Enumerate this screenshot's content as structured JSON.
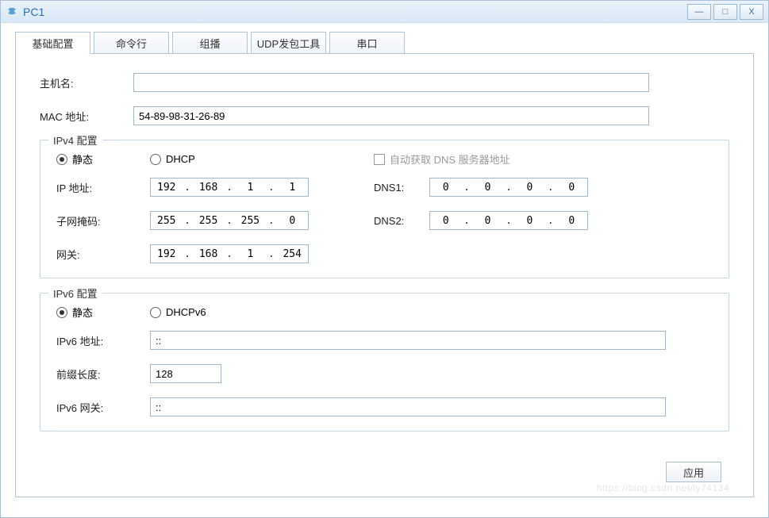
{
  "window": {
    "title": "PC1"
  },
  "tabs": {
    "basic": "基础配置",
    "cmd": "命令行",
    "multicast": "组播",
    "udp": "UDP发包工具",
    "serial": "串口"
  },
  "basic": {
    "hostname_label": "主机名:",
    "hostname_value": "",
    "mac_label": "MAC 地址:",
    "mac_value": "54-89-98-31-26-89"
  },
  "ipv4": {
    "legend": "IPv4 配置",
    "static_label": "静态",
    "dhcp_label": "DHCP",
    "auto_dns_label": "自动获取 DNS 服务器地址",
    "ip_label": "IP 地址:",
    "ip": [
      "192",
      "168",
      "1",
      "1"
    ],
    "mask_label": "子网掩码:",
    "mask": [
      "255",
      "255",
      "255",
      "0"
    ],
    "gw_label": "网关:",
    "gw": [
      "192",
      "168",
      "1",
      "254"
    ],
    "dns1_label": "DNS1:",
    "dns1": [
      "0",
      "0",
      "0",
      "0"
    ],
    "dns2_label": "DNS2:",
    "dns2": [
      "0",
      "0",
      "0",
      "0"
    ]
  },
  "ipv6": {
    "legend": "IPv6 配置",
    "static_label": "静态",
    "dhcp_label": "DHCPv6",
    "addr_label": "IPv6 地址:",
    "addr_value": "::",
    "prefix_label": "前缀长度:",
    "prefix_value": "128",
    "gw_label": "IPv6 网关:",
    "gw_value": "::"
  },
  "footer": {
    "apply_label": "应用",
    "watermark": "https://blog.csdn.net/ly74134"
  }
}
